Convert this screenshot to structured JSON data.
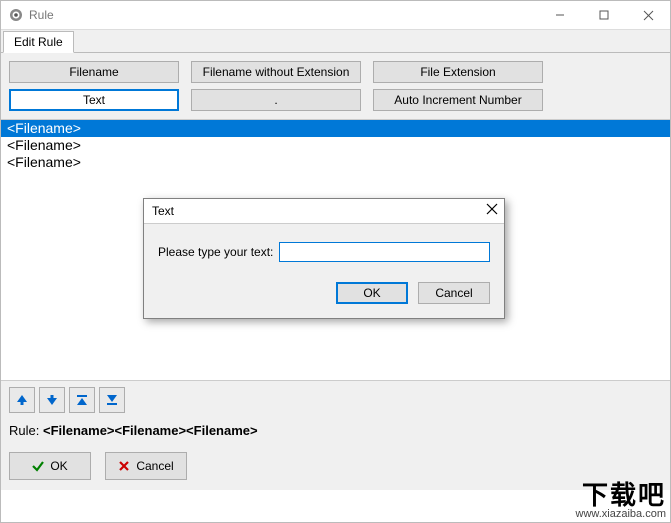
{
  "window": {
    "title": "Rule",
    "controls": {
      "min": "—",
      "max": "▢",
      "close": "✕"
    }
  },
  "tabs": {
    "edit_rule": "Edit Rule"
  },
  "toolbar": {
    "row1": {
      "filename": "Filename",
      "filename_no_ext": "Filename without Extension",
      "file_extension": "File Extension"
    },
    "row2": {
      "text": "Text",
      "dot": ".",
      "auto_increment": "Auto Increment Number"
    }
  },
  "list": {
    "items": [
      "<Filename>",
      "<Filename>",
      "<Filename>"
    ],
    "selected_index": 0
  },
  "text_dialog": {
    "title": "Text",
    "prompt": "Please type your text:",
    "value": "",
    "ok": "OK",
    "cancel": "Cancel"
  },
  "arrow_icons": {
    "up": "arrow-up-icon",
    "down": "arrow-down-icon",
    "top": "arrow-to-top-icon",
    "bottom": "arrow-to-bottom-icon"
  },
  "rule": {
    "label": "Rule:",
    "value": "<Filename><Filename><Filename>"
  },
  "buttons": {
    "ok": "OK",
    "cancel": "Cancel"
  },
  "watermark": {
    "text": "下载吧",
    "url": "www.xiazaiba.com"
  },
  "colors": {
    "selection": "#0078d7",
    "panel_bg": "#f0f0f0",
    "btn_bg": "#e1e1e1",
    "ok_check": "#008000",
    "cancel_x": "#cc0000",
    "arrow": "#0066cc"
  }
}
